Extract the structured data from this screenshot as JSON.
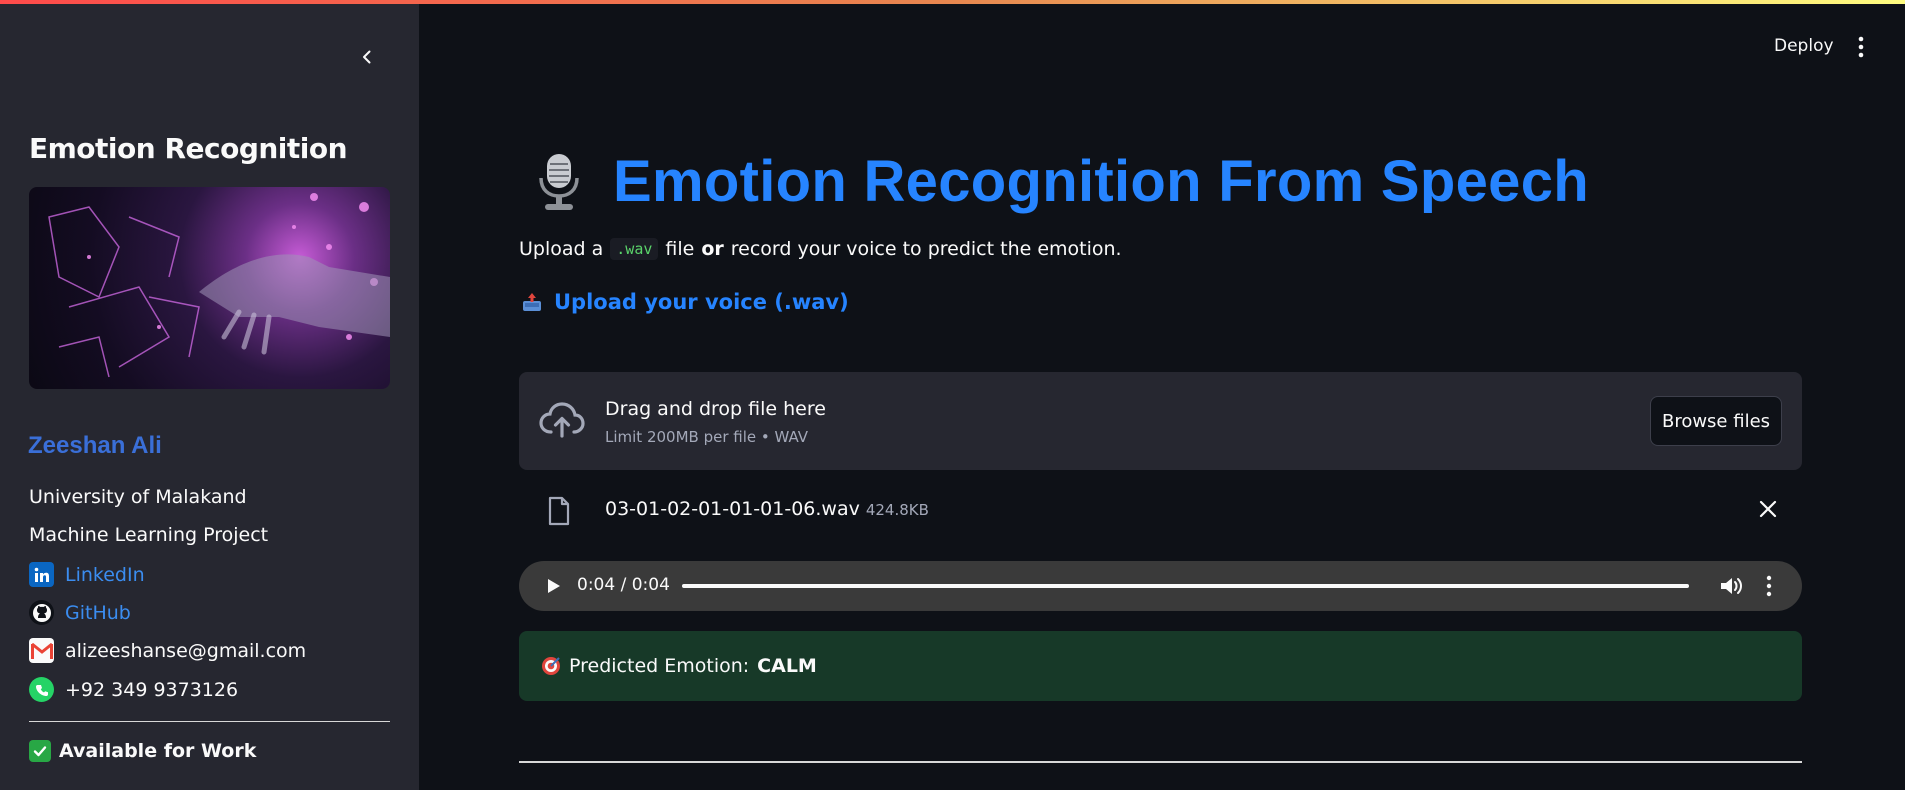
{
  "header": {
    "deploy_label": "Deploy"
  },
  "sidebar": {
    "title": "Emotion Recognition",
    "name": "Zeeshan Ali",
    "university": "University of Malakand",
    "project": "Machine Learning Project",
    "links": [
      {
        "label": "LinkedIn",
        "icon": "linkedin-icon"
      },
      {
        "label": "GitHub",
        "icon": "github-icon"
      }
    ],
    "email": "alizeeshanse@gmail.com",
    "phone": "+92 349 9373126",
    "availability": "Available for Work"
  },
  "main": {
    "title": "Emotion Recognition From Speech",
    "subtitle_part1": "Upload a",
    "subtitle_code": ".wav",
    "subtitle_part2": "file",
    "subtitle_bold": "or",
    "subtitle_part3": "record your voice to predict the emotion.",
    "upload_header": "Upload your voice (.wav)",
    "dropzone": {
      "title": "Drag and drop file here",
      "limit": "Limit 200MB per file • WAV",
      "browse_label": "Browse files"
    },
    "file": {
      "name": "03-01-02-01-01-01-06.wav",
      "size": "424.8KB"
    },
    "audio": {
      "time": "0:04 / 0:04",
      "progress": 1.0
    },
    "result": {
      "label": "Predicted Emotion:",
      "value": "CALM"
    }
  },
  "colors": {
    "accent": "#2684ff",
    "sidebar_bg": "#262730",
    "app_bg": "#0e1117",
    "success_bg": "#173928"
  }
}
